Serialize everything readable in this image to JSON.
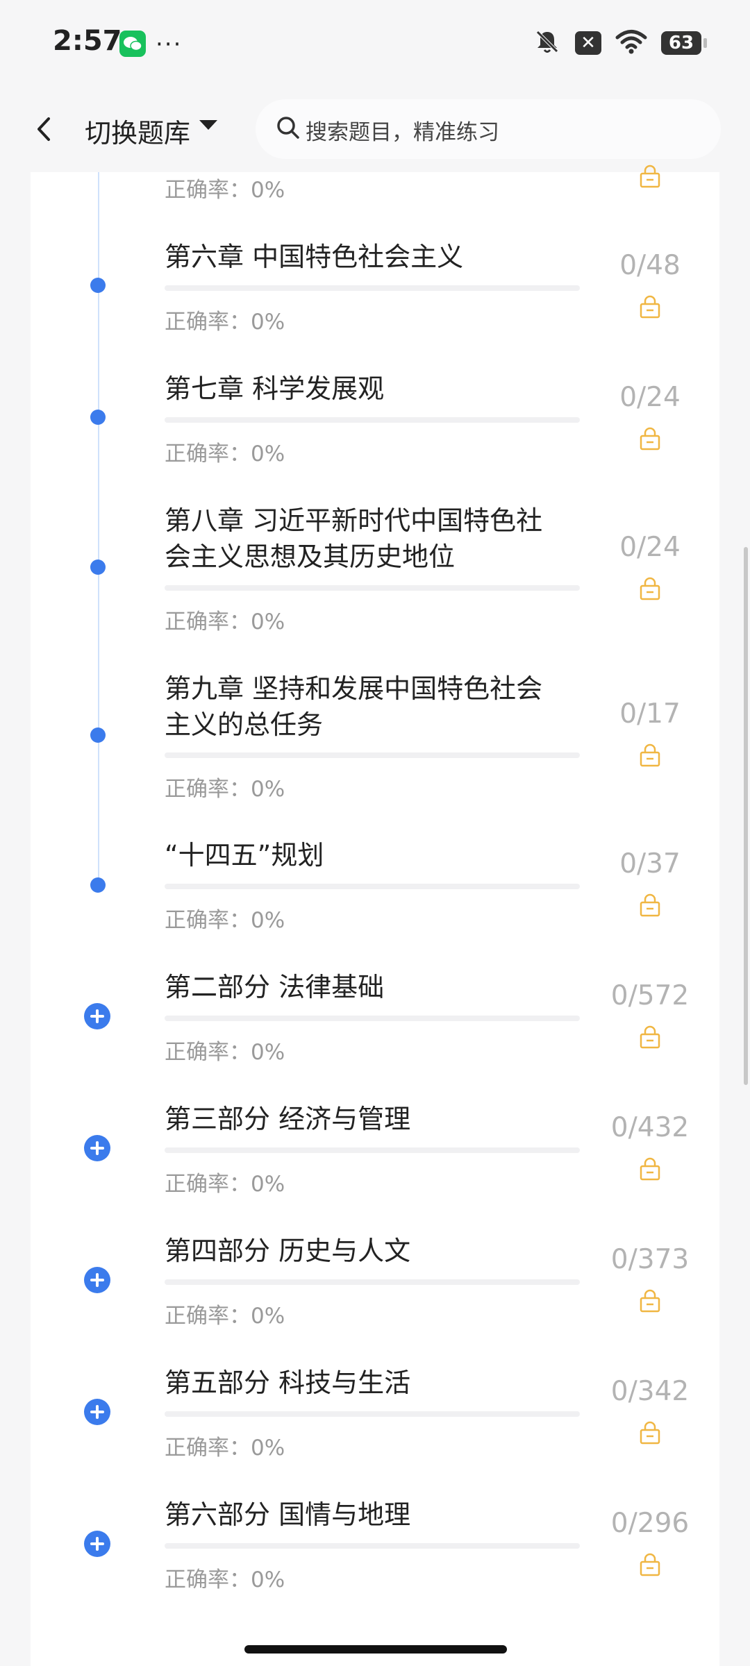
{
  "status_bar": {
    "time": "2:57",
    "more": "···",
    "battery": "63"
  },
  "header": {
    "title": "切换题库",
    "search_placeholder": "搜索题目，精准练习"
  },
  "colors": {
    "accent": "#3b7bec",
    "lock": "#f0b642",
    "count": "#b3b3b3"
  },
  "items": [
    {
      "title": "",
      "accuracy": "正确率：0%",
      "count": "",
      "kind": "chapter",
      "locked": true
    },
    {
      "title": "第六章 中国特色社会主义",
      "accuracy": "正确率：0%",
      "count": "0/48",
      "kind": "chapter",
      "locked": true
    },
    {
      "title": "第七章 科学发展观",
      "accuracy": "正确率：0%",
      "count": "0/24",
      "kind": "chapter",
      "locked": true
    },
    {
      "title": "第八章 习近平新时代中国特色社会主义思想及其历史地位",
      "accuracy": "正确率：0%",
      "count": "0/24",
      "kind": "chapter",
      "locked": true
    },
    {
      "title": "第九章 坚持和发展中国特色社会主义的总任务",
      "accuracy": "正确率：0%",
      "count": "0/17",
      "kind": "chapter",
      "locked": true
    },
    {
      "title": "“十四五”规划",
      "accuracy": "正确率：0%",
      "count": "0/37",
      "kind": "chapter",
      "locked": true
    },
    {
      "title": "第二部分 法律基础",
      "accuracy": "正确率：0%",
      "count": "0/572",
      "kind": "part",
      "locked": true
    },
    {
      "title": "第三部分 经济与管理",
      "accuracy": "正确率：0%",
      "count": "0/432",
      "kind": "part",
      "locked": true
    },
    {
      "title": "第四部分 历史与人文",
      "accuracy": "正确率：0%",
      "count": "0/373",
      "kind": "part",
      "locked": true
    },
    {
      "title": "第五部分 科技与生活",
      "accuracy": "正确率：0%",
      "count": "0/342",
      "kind": "part",
      "locked": true
    },
    {
      "title": "第六部分 国情与地理",
      "accuracy": "正确率：0%",
      "count": "0/296",
      "kind": "part",
      "locked": true
    }
  ]
}
